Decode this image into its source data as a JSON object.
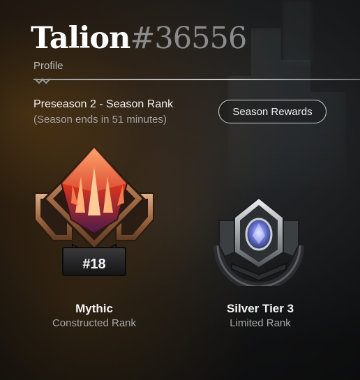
{
  "profile": {
    "name": "Talion",
    "tag": "#36556",
    "subtitle": "Profile"
  },
  "season": {
    "title": "Preseason 2 - Season Rank",
    "ends": "(Season ends in 51 minutes)",
    "rewards_button": "Season Rewards"
  },
  "ranks": [
    {
      "tier": "Mythic",
      "format": "Constructed Rank",
      "position": "#18",
      "icon": "mythic-rank-icon"
    },
    {
      "tier": "Silver Tier 3",
      "format": "Limited Rank",
      "icon": "silver-rank-icon"
    }
  ],
  "colors": {
    "accent_mythic": "#e0502a",
    "bronze_frame": "#b27a52",
    "silver": "#c8ccd0",
    "gem": "#6b78d8"
  }
}
